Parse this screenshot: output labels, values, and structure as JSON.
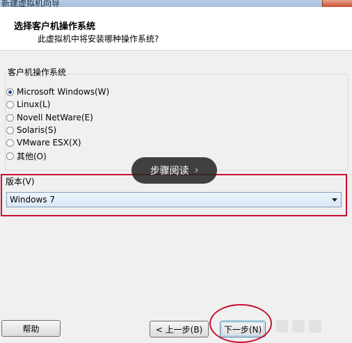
{
  "window": {
    "title": "新建虚拟机向导"
  },
  "header": {
    "title": "选择客户机操作系统",
    "subtitle": "此虚拟机中将安装哪种操作系统?"
  },
  "guest_os": {
    "group_label": "客户机操作系统",
    "options": [
      {
        "label": "Microsoft Windows(W)",
        "selected": true
      },
      {
        "label": "Linux(L)",
        "selected": false
      },
      {
        "label": "Novell NetWare(E)",
        "selected": false
      },
      {
        "label": "Solaris(S)",
        "selected": false
      },
      {
        "label": "VMware ESX(X)",
        "selected": false
      },
      {
        "label": "其他(O)",
        "selected": false
      }
    ]
  },
  "version": {
    "label": "版本(V)",
    "selected": "Windows 7"
  },
  "toast": {
    "label": "步骤阅读",
    "chevron": "›"
  },
  "buttons": {
    "help": "帮助",
    "back": "< 上一步(B)",
    "next": "下一步(N)"
  },
  "colors": {
    "annotation_red": "#c8102e",
    "header_bg": "#ffffff",
    "dialog_bg": "#f0f0f0"
  },
  "icons": {
    "radio_selected": "radio-selected-icon",
    "radio_unselected": "radio-unselected-icon",
    "dropdown": "chevron-down-icon"
  }
}
